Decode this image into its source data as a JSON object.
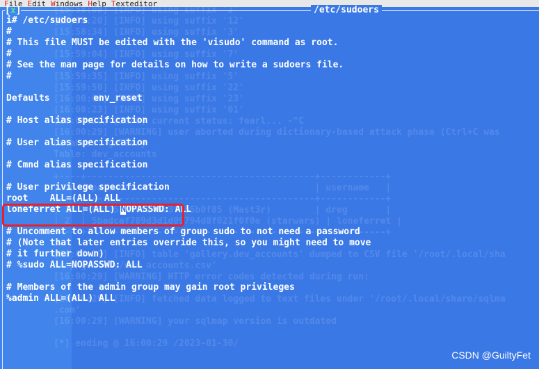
{
  "menubar": {
    "items": [
      "File",
      "Edit",
      "Windows",
      "Help",
      "Texteditor"
    ]
  },
  "window": {
    "title": "/etc/sudoers",
    "close_label": "x"
  },
  "editor": {
    "lines": [
      "i# /etc/sudoers",
      "#",
      "# This file MUST be edited with the 'visudo' command as root.",
      "#",
      "# See the man page for details on how to write a sudoers file.",
      "#",
      "",
      "Defaults        env_reset",
      "",
      "# Host alias specification",
      "",
      "# User alias specification",
      "",
      "# Cmnd alias specification",
      "",
      "# User privilege specification",
      "root    ALL=(ALL) ALL",
      "loneferret ALL=(ALL) NOPASSWD: ALL",
      "",
      "# Uncomment to allow members of group sudo to not need a password",
      "# (Note that later entries override this, so you might need to move",
      "# it further down)",
      "# %sudo ALL=NOPASSWD: ALL",
      "",
      "# Members of the admin group may gain root privileges",
      "%admin ALL=(ALL) ALL"
    ],
    "cursor_line": 17,
    "cursor_before": "loneferret ALL=(ALL) ",
    "cursor_char": "N",
    "cursor_after": "OPASSWD: ALL"
  },
  "background_terminal": {
    "lines": [
      "[15:58:09] [INFO] using suffix '2'",
      "[15:58:20] [INFO] using suffix '12'",
      "[15:58:34] [INFO] using suffix '3'",
      "",
      "[15:59:04] [INFO] using suffix '7'",
      "",
      "[15:59:35] [INFO] using suffix '5'",
      "[15:59:50] [INFO] using suffix '22'",
      "[16:00:06] [INFO] using suffix '23'",
      "[16:00:23] [INFO] using suffix '01'",
      "[16:00:28] [INFO] current status: fearl... -^C",
      "[16:00:29] [WARNING] user aborted during dictionary-based attack phase (Ctrl+C was",
      "Database: gallery",
      "Table: dev_accounts",
      "",
      "+----+------------------------------------------+------------+",
      "| id | password                                 | username   |",
      "+----+------------------------------------------+------------+",
      "| 1  | 0d3753d50f243b3f155b0f85 (Mast3r)        | dreg       |",
      "| 2  | 5badcaf789d3d1d09794d8f021f0f0e (starwars) | loneferret |",
      "+----+------------------------------------------+------------+",
      "",
      "[16:00:29] [INFO] table 'gallery.dev_accounts' dumped to CSV file '/root/.local/sha",
      "dump/gallery/dev_accounts.csv'",
      "[16:00:29] [WARNING] HTTP error codes detected during run:",
      "",
      "[16:00:29] [INFO] fetched data logged to text files under '/root/.local/share/sqlma",
      ".com'",
      "[16:00:29] [WARNING] your sqlmap version is outdated",
      "",
      "[*] ending @ 16:00:29 /2023-01-30/"
    ]
  },
  "watermark": "CSDN @GuiltyFet",
  "colors": {
    "background": "#3a78e6",
    "highlight_box": "#e8202a",
    "close_x": "#4fe0a0"
  }
}
